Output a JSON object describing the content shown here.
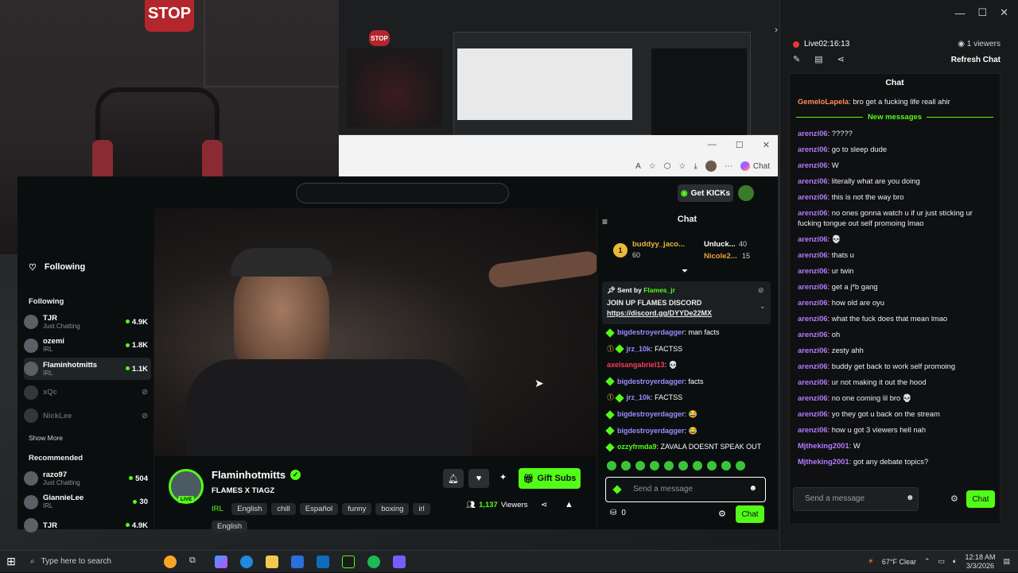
{
  "webcam": {
    "stop_sign_text": "STOP"
  },
  "capture_window": {
    "stop_sign_text": "STOP"
  },
  "chat_window": {
    "live_label": "Live",
    "live_time": "02:16:13",
    "viewers": "1 viewers",
    "refresh_label": "Refresh Chat",
    "chat_header": "Chat",
    "new_messages_label": "New messages",
    "input_placeholder": "Send a message",
    "chat_button": "Chat",
    "messages": [
      {
        "user": "GemeloLapela",
        "text": "bro get a fucking life reall ahir",
        "color": "#ff8c5a"
      },
      {
        "user": "arenzi06",
        "text": "?????",
        "color": "#b17cff"
      },
      {
        "user": "arenzi06",
        "text": "go to sleep dude",
        "color": "#b17cff"
      },
      {
        "user": "arenzi06",
        "text": "W",
        "color": "#b17cff"
      },
      {
        "user": "arenzi06",
        "text": "literally what are you doing",
        "color": "#b17cff"
      },
      {
        "user": "arenzi06",
        "text": "this is not the way bro",
        "color": "#b17cff"
      },
      {
        "user": "arenzi06",
        "text": "no ones gonna watch u if ur just sticking ur fucking tongue out self promoing lmao",
        "color": "#b17cff"
      },
      {
        "user": "arenzi06",
        "text": "💀",
        "color": "#b17cff"
      },
      {
        "user": "arenzi06",
        "text": "thats u",
        "color": "#b17cff"
      },
      {
        "user": "arenzi06",
        "text": "ur twin",
        "color": "#b17cff"
      },
      {
        "user": "arenzi06",
        "text": "get a j*b gang",
        "color": "#b17cff"
      },
      {
        "user": "arenzi06",
        "text": "how old are oyu",
        "color": "#b17cff"
      },
      {
        "user": "arenzi06",
        "text": "what the fuck does that mean lmao",
        "color": "#b17cff"
      },
      {
        "user": "arenzi06",
        "text": "oh",
        "color": "#b17cff"
      },
      {
        "user": "arenzi06",
        "text": "zesty ahh",
        "color": "#b17cff"
      },
      {
        "user": "arenzi06",
        "text": "buddy get back to work self promoing",
        "color": "#b17cff"
      },
      {
        "user": "arenzi06",
        "text": "ur not making it out the hood",
        "color": "#b17cff"
      },
      {
        "user": "arenzi06",
        "text": "no one coming lil bro 💀",
        "color": "#b17cff"
      },
      {
        "user": "arenzi06",
        "text": "yo they got u back on the stream",
        "color": "#b17cff"
      },
      {
        "user": "arenzi06",
        "text": "how u got 3 viewers hell nah",
        "color": "#b17cff"
      },
      {
        "user": "Mjtheking2001",
        "text": "W",
        "color": "#b17cff"
      },
      {
        "user": "Mjtheking2001",
        "text": "got any debate topics?",
        "color": "#b17cff"
      }
    ]
  },
  "browser": {
    "read_aloud": "A",
    "chat_label": "Chat",
    "get_kicks": "Get KICKs"
  },
  "sidebar": {
    "following_header": "Following",
    "following_section": "Following",
    "show_more": "Show More",
    "recommended": "Recommended",
    "following": [
      {
        "name": "TJR",
        "category": "Just Chatting",
        "viewers": "4.9K"
      },
      {
        "name": "ozemi",
        "category": "IRL",
        "viewers": "1.8K"
      },
      {
        "name": "Flaminhotmitts",
        "category": "IRL",
        "viewers": "1.1K"
      },
      {
        "name": "xQc",
        "category": "",
        "viewers": ""
      },
      {
        "name": "NickLee",
        "category": "",
        "viewers": ""
      }
    ],
    "recommended_list": [
      {
        "name": "razo97",
        "category": "Just Chatting",
        "viewers": "504"
      },
      {
        "name": "GiannieLee",
        "category": "IRL",
        "viewers": "30"
      },
      {
        "name": "TJR",
        "category": "",
        "viewers": "4.9K"
      }
    ]
  },
  "stream": {
    "streamer": "Flaminhotmitts",
    "title": "FLAMES X TIAGZ",
    "category": "IRL",
    "tags": [
      "English",
      "chill",
      "Español",
      "funny",
      "boxing",
      "irl",
      "English"
    ],
    "viewers": "1,137",
    "viewers_label": "Viewers",
    "gift_subs": "Gift Subs",
    "live_badge": "LIVE"
  },
  "kick_chat": {
    "header": "Chat",
    "top_gifters": [
      {
        "name": "buddyy_jaco...",
        "count": "60",
        "rank": "1"
      },
      {
        "name": "Unluck...",
        "count": "40"
      },
      {
        "name": "Nicole2...",
        "count": "15"
      }
    ],
    "pinned": {
      "sent_by_label": "Sent by",
      "sender": "Flames_jr",
      "line1": "JOIN UP FLAMES DISCORD",
      "link": "https://discord.gg/DYYDe22MX"
    },
    "messages": [
      {
        "user": "bigdestroyerdagger",
        "text": "man facts",
        "color": "#9b8cff"
      },
      {
        "user": "jrz_10k",
        "text": "FACTSS",
        "color": "#9b8cff"
      },
      {
        "user": "axelsangabriel13",
        "text": "💀",
        "color": "#ff3b5c"
      },
      {
        "user": "bigdestroyerdagger",
        "text": "facts",
        "color": "#9b8cff"
      },
      {
        "user": "jrz_10k",
        "text": "FACTSS",
        "color": "#9b8cff"
      },
      {
        "user": "bigdestroyerdagger",
        "text": "😂",
        "color": "#9b8cff"
      },
      {
        "user": "bigdestroyerdagger",
        "text": "😂",
        "color": "#9b8cff"
      },
      {
        "user": "ozzyfrmda9",
        "text": "ZAVALA DOESNT SPEAK OUT",
        "color": "#53fc18"
      }
    ],
    "input_placeholder": "Send a message",
    "points": "0",
    "chat_button": "Chat"
  },
  "taskbar": {
    "search_placeholder": "Type here to search",
    "weather": "67°F  Clear",
    "time": "12:18 AM",
    "date": "3/3/2026"
  },
  "colors": {
    "kick_green": "#53fc18",
    "live_red": "#e53935",
    "purple_user": "#b17cff"
  }
}
